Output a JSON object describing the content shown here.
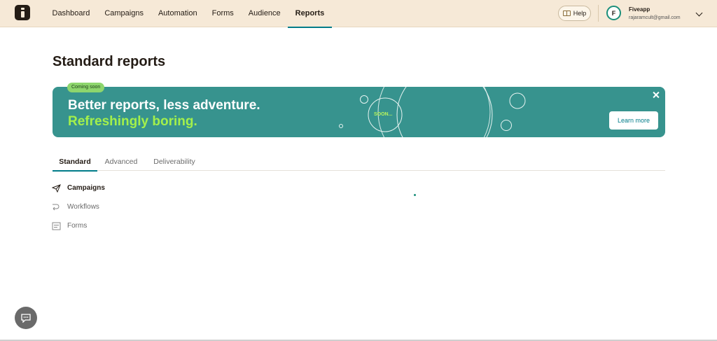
{
  "nav": {
    "items": [
      {
        "label": "Dashboard"
      },
      {
        "label": "Campaigns"
      },
      {
        "label": "Automation"
      },
      {
        "label": "Forms"
      },
      {
        "label": "Audience"
      },
      {
        "label": "Reports",
        "active": true
      }
    ],
    "help_label": "Help",
    "account": {
      "initial": "F",
      "name": "Fiveapp",
      "email": "rajaramcult@gmail.com"
    }
  },
  "page": {
    "title": "Standard reports"
  },
  "banner": {
    "badge": "Coming soon",
    "headline": "Better reports, less adventure.",
    "subheadline": "Refreshingly boring.",
    "soon_label": "SOON...",
    "cta_label": "Learn more",
    "color_bg": "#37938e",
    "color_accent": "#a3f04b"
  },
  "tabs": [
    {
      "label": "Standard",
      "active": true
    },
    {
      "label": "Advanced"
    },
    {
      "label": "Deliverability"
    }
  ],
  "reports": [
    {
      "label": "Campaigns",
      "icon": "send-icon",
      "active": true
    },
    {
      "label": "Workflows",
      "icon": "workflow-icon"
    },
    {
      "label": "Forms",
      "icon": "form-icon"
    }
  ],
  "colors": {
    "topbar": "#f6e9d7",
    "accent": "#007c89"
  }
}
